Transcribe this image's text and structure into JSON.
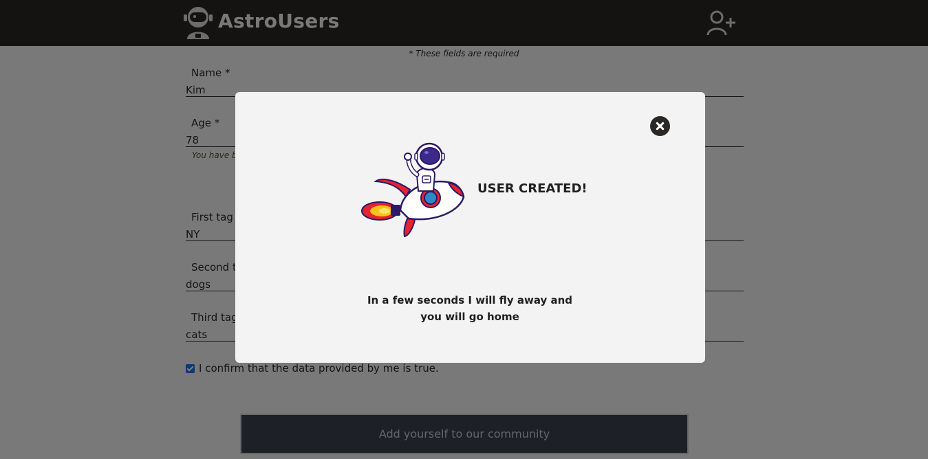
{
  "header": {
    "brand": "AstroUsers"
  },
  "form": {
    "required_note": "* These fields are required",
    "name": {
      "label": "Name *",
      "value": "Kim"
    },
    "age": {
      "label": "Age *",
      "value": "78",
      "hint": "You have b"
    },
    "first_tag": {
      "label": "First tag",
      "value": "NY"
    },
    "second_tag": {
      "label": "Second t",
      "value": "dogs"
    },
    "third_tag": {
      "label": "Third tag",
      "value": "cats"
    },
    "confirm_label": "I confirm that the data provided by me is true.",
    "confirm_checked": true,
    "submit_label": "Add yourself to our community"
  },
  "modal": {
    "title": "USER CREATED!",
    "message": "In a few seconds I will fly away and you will go home"
  },
  "colors": {
    "header_bg": "#2b2725",
    "submit_bg": "#3c4150",
    "checkbox": "#1a73e8"
  },
  "icons": {
    "logo": "astronaut-logo-icon",
    "add_user": "add-user-icon",
    "close": "close-icon",
    "rocket": "astronaut-rocket-illustration"
  }
}
